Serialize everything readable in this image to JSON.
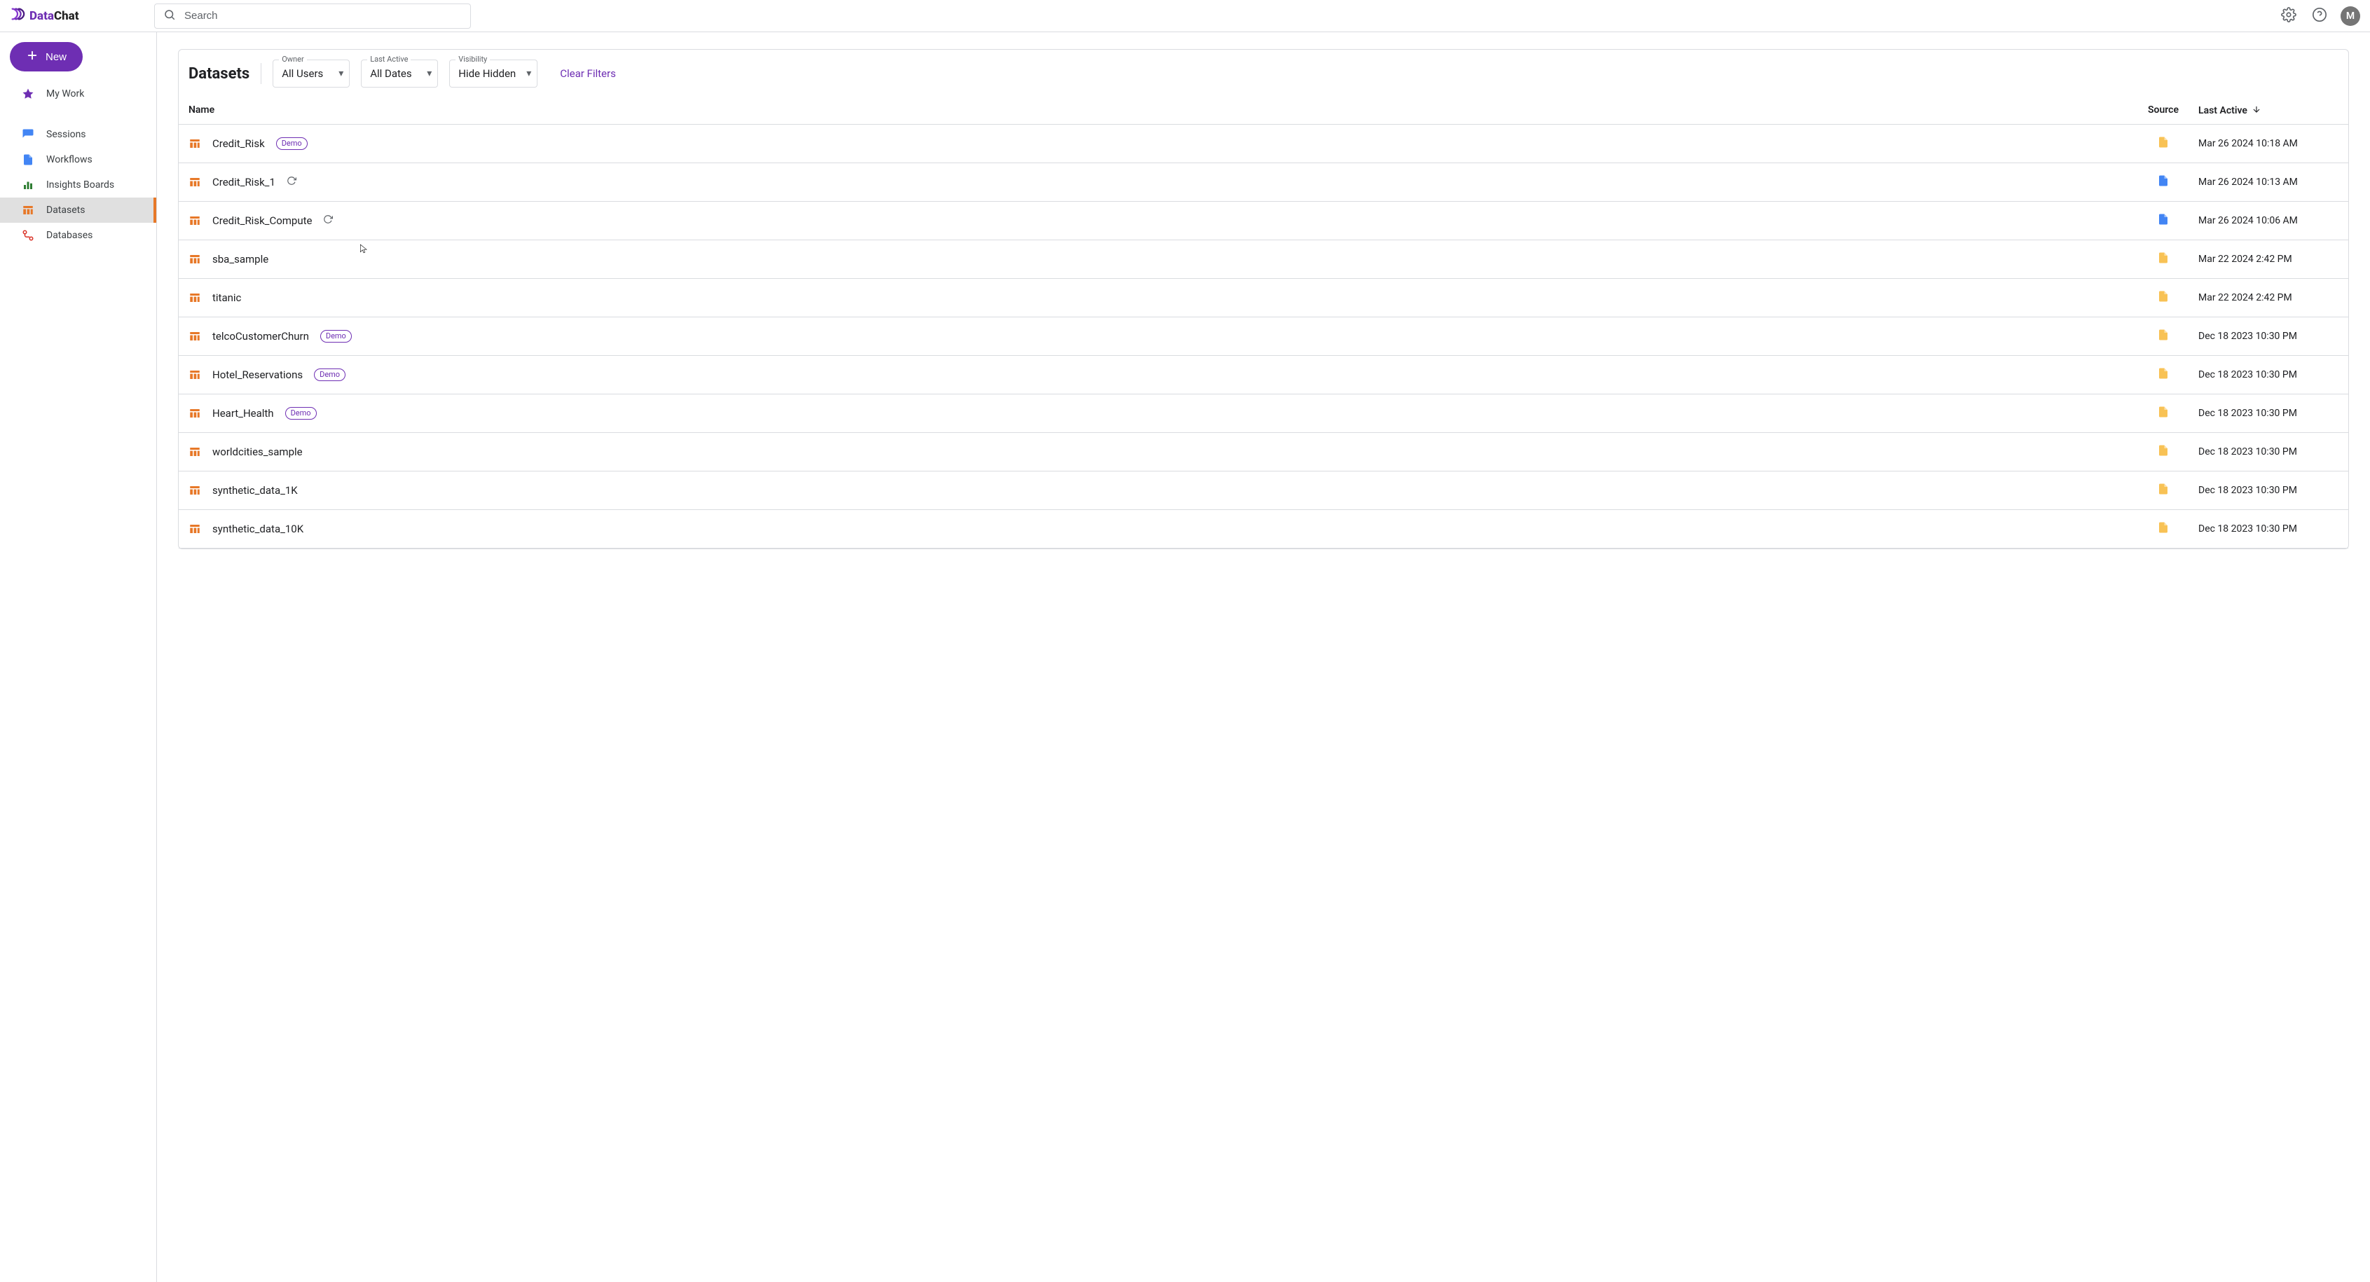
{
  "brand": {
    "part1": "Data",
    "part2": "Chat"
  },
  "header": {
    "search_placeholder": "Search",
    "avatar_initial": "M"
  },
  "sidebar": {
    "new_label": "New",
    "items": [
      {
        "id": "my-work",
        "label": "My Work"
      },
      {
        "id": "sessions",
        "label": "Sessions"
      },
      {
        "id": "workflows",
        "label": "Workflows"
      },
      {
        "id": "insights",
        "label": "Insights Boards"
      },
      {
        "id": "datasets",
        "label": "Datasets"
      },
      {
        "id": "databases",
        "label": "Databases"
      }
    ],
    "active_id": "datasets"
  },
  "page": {
    "title": "Datasets",
    "filters": {
      "owner": {
        "label": "Owner",
        "value": "All Users"
      },
      "last_active": {
        "label": "Last Active",
        "value": "All Dates"
      },
      "visibility": {
        "label": "Visibility",
        "value": "Hide Hidden"
      }
    },
    "clear_filters": "Clear Filters",
    "columns": {
      "name": "Name",
      "source": "Source",
      "last_active": "Last Active"
    },
    "demo_badge": "Demo",
    "rows": [
      {
        "name": "Credit_Risk",
        "demo": true,
        "refresh": false,
        "source": "file-yellow",
        "last_active": "Mar 26 2024 10:18 AM"
      },
      {
        "name": "Credit_Risk_1",
        "demo": false,
        "refresh": true,
        "source": "file-blue",
        "last_active": "Mar 26 2024 10:13 AM"
      },
      {
        "name": "Credit_Risk_Compute",
        "demo": false,
        "refresh": true,
        "source": "file-blue",
        "last_active": "Mar 26 2024 10:06 AM"
      },
      {
        "name": "sba_sample",
        "demo": false,
        "refresh": false,
        "source": "file-yellow",
        "last_active": "Mar 22 2024 2:42 PM"
      },
      {
        "name": "titanic",
        "demo": false,
        "refresh": false,
        "source": "file-yellow",
        "last_active": "Mar 22 2024 2:42 PM"
      },
      {
        "name": "telcoCustomerChurn",
        "demo": true,
        "refresh": false,
        "source": "file-yellow",
        "last_active": "Dec 18 2023 10:30 PM"
      },
      {
        "name": "Hotel_Reservations",
        "demo": true,
        "refresh": false,
        "source": "file-yellow",
        "last_active": "Dec 18 2023 10:30 PM"
      },
      {
        "name": "Heart_Health",
        "demo": true,
        "refresh": false,
        "source": "file-yellow",
        "last_active": "Dec 18 2023 10:30 PM"
      },
      {
        "name": "worldcities_sample",
        "demo": false,
        "refresh": false,
        "source": "file-yellow",
        "last_active": "Dec 18 2023 10:30 PM"
      },
      {
        "name": "synthetic_data_1K",
        "demo": false,
        "refresh": false,
        "source": "file-yellow",
        "last_active": "Dec 18 2023 10:30 PM"
      },
      {
        "name": "synthetic_data_10K",
        "demo": false,
        "refresh": false,
        "source": "file-yellow",
        "last_active": "Dec 18 2023 10:30 PM"
      }
    ]
  }
}
